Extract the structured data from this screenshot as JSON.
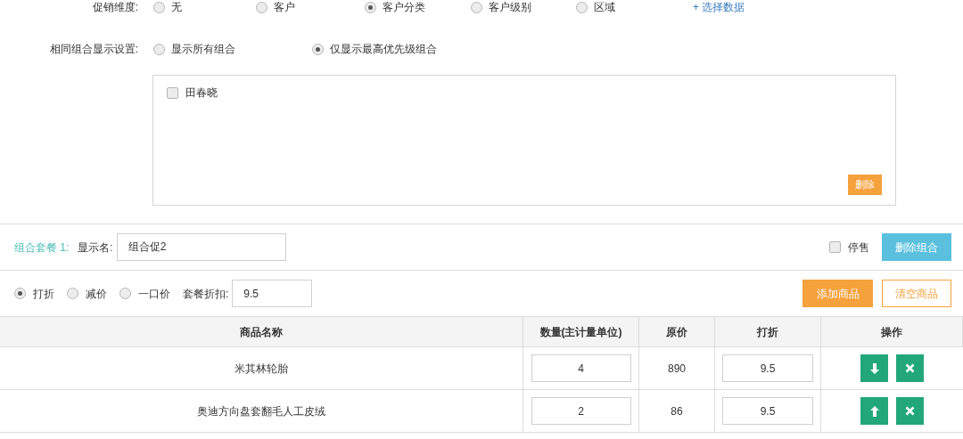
{
  "promo_dimension": {
    "label": "促销维度:",
    "options": [
      {
        "label": "无",
        "selected": false
      },
      {
        "label": "客户",
        "selected": false
      },
      {
        "label": "客户分类",
        "selected": true
      },
      {
        "label": "客户级别",
        "selected": false
      },
      {
        "label": "区域",
        "selected": false
      }
    ],
    "select_link": "+ 选择数据"
  },
  "same_combo_display": {
    "label": "相同组合显示设置:",
    "options": [
      {
        "label": "显示所有组合",
        "selected": false
      },
      {
        "label": "仅显示最高优先级组合",
        "selected": true
      }
    ]
  },
  "selection_box": {
    "items": [
      {
        "label": "田春晓",
        "checked": false
      }
    ],
    "delete_button": "删除"
  },
  "combo": {
    "title": "组合套餐 1:",
    "name_label": "显示名:",
    "name_value": "组合促2",
    "stop_sale": {
      "label": "停售",
      "checked": false
    },
    "delete_button": "删除组合",
    "pricing_modes": [
      {
        "label": "打折",
        "selected": true
      },
      {
        "label": "减价",
        "selected": false
      },
      {
        "label": "一口价",
        "selected": false
      }
    ],
    "discount_label": "套餐折扣:",
    "discount_value": "9.5",
    "add_button": "添加商品",
    "clear_button": "清空商品"
  },
  "table": {
    "columns": [
      "商品名称",
      "数量(主计量单位)",
      "原价",
      "打折",
      "操作"
    ],
    "rows": [
      {
        "name": "米其林轮胎",
        "quantity": "4",
        "price": "890",
        "discount": "9.5",
        "kind": "down"
      },
      {
        "name": "奥迪方向盘套翻毛人工皮绒",
        "quantity": "2",
        "price": "86",
        "discount": "9.5",
        "kind": "up"
      }
    ]
  }
}
